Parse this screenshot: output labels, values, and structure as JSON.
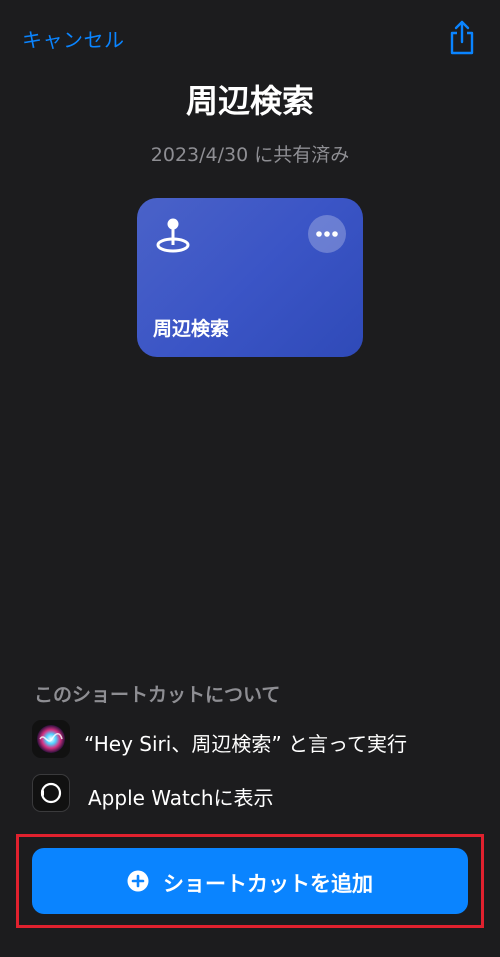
{
  "nav": {
    "cancel_label": "キャンセル"
  },
  "title": "周辺検索",
  "subtitle": "2023/4/30 に共有済み",
  "card": {
    "label": "周辺検索",
    "icon": "map-pin-icon",
    "color": "#3b55c6"
  },
  "about": {
    "section_title": "このショートカットについて",
    "siri_text": "“Hey Siri、周辺検索” と言って実行",
    "watch_text": "Apple Watchに表示"
  },
  "add_button": {
    "label": "ショートカットを追加",
    "color": "#0a84ff"
  },
  "highlight_color": "#e0212e"
}
